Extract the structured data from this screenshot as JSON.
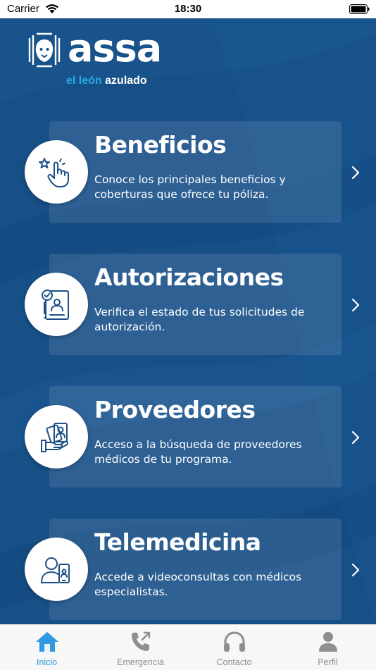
{
  "status_bar": {
    "carrier": "Carrier",
    "time": "18:30"
  },
  "brand": {
    "name": "assa",
    "tagline_accent": "el león",
    "tagline_rest": "azulado"
  },
  "cards": [
    {
      "title": "Beneficios",
      "description": "Conoce los principales beneficios y coberturas que ofrece tu póliza.",
      "icon": "hand-tap-stars-icon"
    },
    {
      "title": "Autorizaciones",
      "description": "Verifica el estado de tus solicitudes de autorización.",
      "icon": "authorization-document-icon"
    },
    {
      "title": "Proveedores",
      "description": "Acceso a la búsqueda de proveedores médicos de tu programa.",
      "icon": "provider-cards-icon"
    },
    {
      "title": "Telemedicina",
      "description": "Accede a videoconsultas con médicos especialistas.",
      "icon": "telemedicine-icon"
    }
  ],
  "tabs": [
    {
      "label": "Inicio",
      "icon": "home-icon",
      "active": true
    },
    {
      "label": "Emergencia",
      "icon": "phone-call-icon",
      "active": false
    },
    {
      "label": "Contacto",
      "icon": "headphones-icon",
      "active": false
    },
    {
      "label": "Perfil",
      "icon": "user-icon",
      "active": false
    }
  ],
  "colors": {
    "background": "#174f87",
    "accent": "#29a9e6",
    "tab_active": "#2f9ae0",
    "icon": "#1d4f86"
  }
}
